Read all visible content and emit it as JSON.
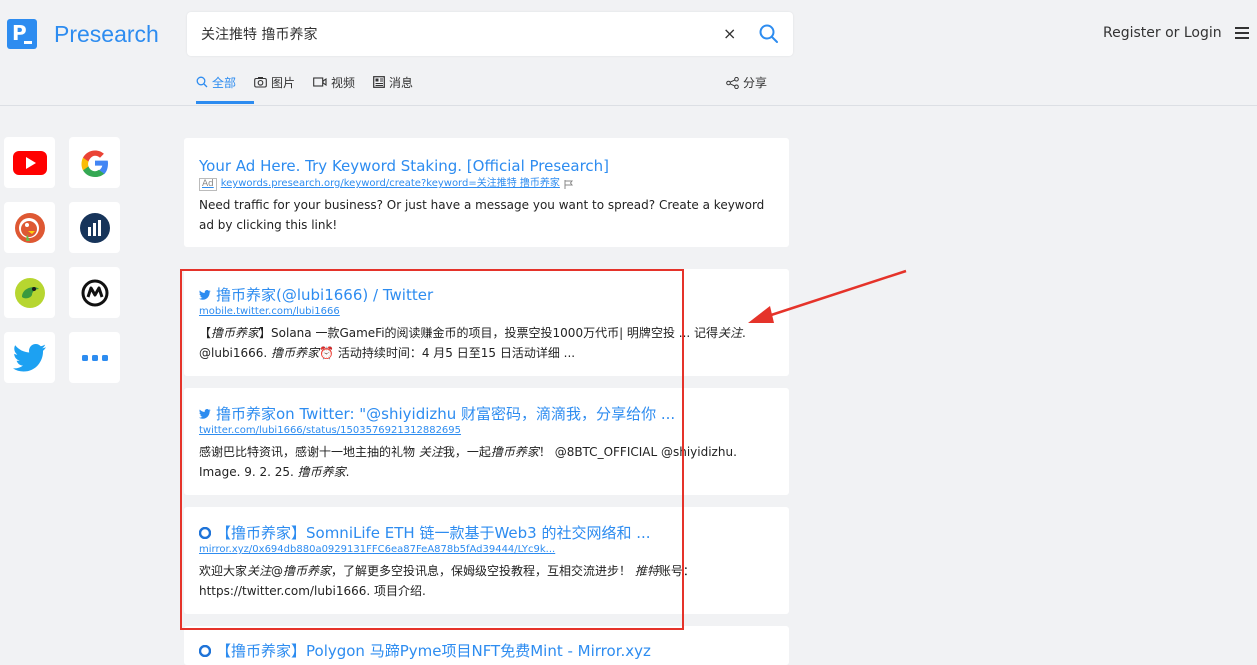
{
  "header": {
    "logo_text": "Presearch",
    "logo_letter": "P",
    "search_value": "关注推特 撸币养家",
    "clear_label": "×",
    "login_label": "Register or Login"
  },
  "tabs": [
    {
      "label": "全部",
      "icon": "search-icon",
      "active": true
    },
    {
      "label": "图片",
      "icon": "camera-icon",
      "active": false
    },
    {
      "label": "视频",
      "icon": "video-icon",
      "active": false
    },
    {
      "label": "消息",
      "icon": "news-icon",
      "active": false
    }
  ],
  "share_label": "分享",
  "sidebar": [
    "youtube-icon",
    "google-icon",
    "duckduckgo-icon",
    "coinmarketcap-icon",
    "ecosia-icon",
    "coinmarketcap-m-icon",
    "twitter-icon",
    "more-icon"
  ],
  "colors": {
    "accent": "#2d8cf0",
    "highlight": "#e5332a"
  },
  "results": [
    {
      "title": "Your Ad Here. Try Keyword Staking. [Official Presearch]",
      "ad_label": "Ad",
      "url": "keywords.presearch.org/keyword/create?keyword=关注推特 撸币养家",
      "desc": "Need traffic for your business? Or just have a message you want to spread? Create a keyword ad by clicking this link!"
    },
    {
      "title": "撸币养家(@lubi1666) / Twitter",
      "url": "mobile.twitter.com/lubi1666",
      "desc_parts": [
        "【",
        "撸币养家",
        "】Solana 一款GameFi的阅读赚金币的项目，投票空投1000万代币| 明牌空投 ... 记得",
        "关注",
        ". @lubi1666. ",
        "撸币养家",
        "⏰ 活动持续时间：4 月5 日至15 日活动详细 ..."
      ]
    },
    {
      "title": "撸币养家on Twitter: \"@shiyidizhu 财富密码，滴滴我，分享给你 ...",
      "url": "twitter.com/lubi1666/status/1503576921312882695",
      "desc_parts": [
        "感谢巴比特资讯，感谢十一地主抽的礼物 ",
        "关注",
        "我，一起",
        "撸币养家",
        "！ @8BTC_OFFICIAL @shiyidizhu. Image. 9. 2. 25. ",
        "撸币养家",
        "."
      ]
    },
    {
      "title": "【撸币养家】SomniLife ETH 链一款基于Web3 的社交网络和 ...",
      "url": "mirror.xyz/0x694db880a0929131FFC6ea87FeA878b5fAd39444/LYc9k...",
      "desc_parts": [
        "欢迎大家",
        "关注",
        "@",
        "撸币养家",
        "，了解更多空投讯息，保姆级空投教程，互相交流进步！ ",
        "推特",
        "账号：https://twitter.com/lubi1666. 项目介绍."
      ]
    },
    {
      "title": "【撸币养家】Polygon 马蹄Pyme项目NFT免费Mint - Mirror.xyz"
    }
  ]
}
